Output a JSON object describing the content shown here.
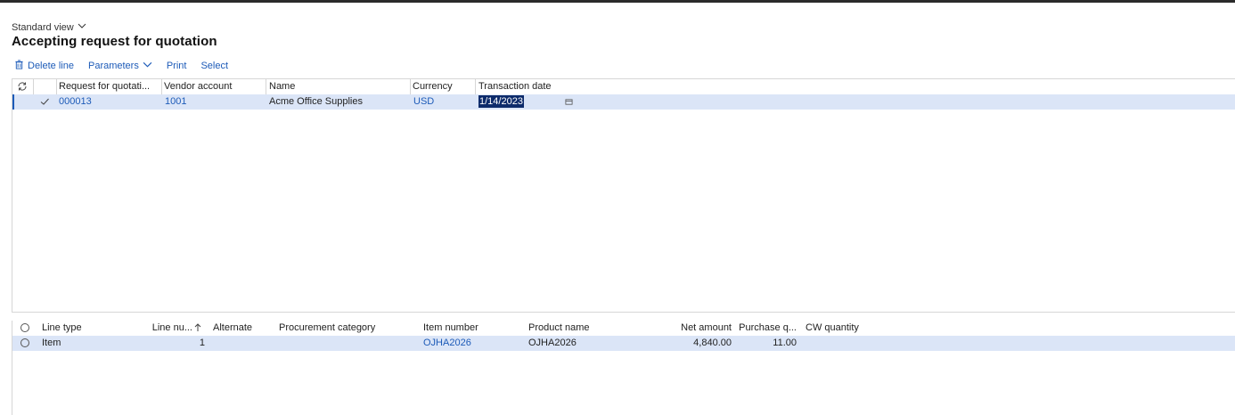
{
  "view": {
    "label": "Standard view"
  },
  "page": {
    "title": "Accepting request for quotation"
  },
  "actions": {
    "delete_line": "Delete line",
    "parameters": "Parameters",
    "print": "Print",
    "select": "Select"
  },
  "header_grid": {
    "columns": [
      "Request for quotati...",
      "Vendor account",
      "Name",
      "Currency",
      "Transaction date"
    ],
    "rows": [
      {
        "rfq": "000013",
        "vendor": "1001",
        "name": "Acme Office Supplies",
        "currency": "USD",
        "date": "1/14/2023"
      }
    ]
  },
  "lines_grid": {
    "columns": [
      "Line type",
      "Line nu...",
      "Alternate",
      "Procurement category",
      "Item number",
      "Product name",
      "Net amount",
      "Purchase q...",
      "CW quantity"
    ],
    "rows": [
      {
        "line_type": "Item",
        "line_number": "1",
        "alternate": "",
        "category": "",
        "item_number": "OJHA2026",
        "product_name": "OJHA2026",
        "net_amount": "4,840.00",
        "purchase_qty": "11.00",
        "cw_quantity": ""
      }
    ]
  },
  "colors": {
    "accent": "#1d5bb8",
    "selected_row": "#dbe5f7",
    "date_highlight": "#0d2b6b"
  },
  "icons": [
    "chevron-down-icon",
    "trash-icon",
    "refresh-icon",
    "checkmark-icon",
    "calendar-icon",
    "sort-up-arrow-icon",
    "radio-icon"
  ]
}
